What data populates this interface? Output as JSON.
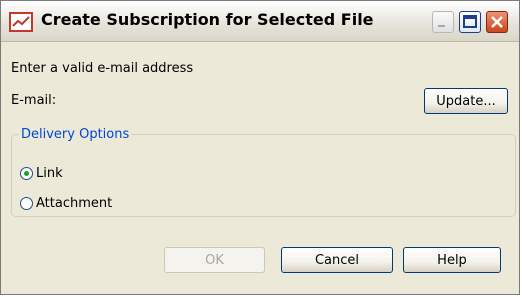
{
  "window": {
    "title": "Create Subscription for Selected File",
    "icon": "chart-icon"
  },
  "form": {
    "prompt": "Enter a valid e-mail address",
    "email_label": "E-mail:",
    "update_label": "Update..."
  },
  "delivery": {
    "legend": "Delivery Options",
    "options": [
      {
        "label": "Link",
        "selected": true
      },
      {
        "label": "Attachment",
        "selected": false
      }
    ]
  },
  "buttons": {
    "ok": "OK",
    "cancel": "Cancel",
    "help": "Help"
  }
}
